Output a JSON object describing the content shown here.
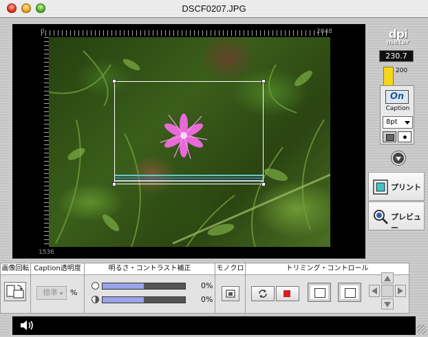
{
  "window": {
    "title": "DSCF0207.JPG"
  },
  "viewer": {
    "ruler_x_start": "0",
    "ruler_x_end": "2048",
    "ruler_y_end": "1536"
  },
  "dpi_meter": {
    "logo_top": "dpi",
    "logo_bottom": "meter",
    "value": "230.7",
    "max_label": "200"
  },
  "caption_panel": {
    "on_label": "On",
    "label": "Caption",
    "font_size": "8pt"
  },
  "side_buttons": {
    "print_label": "プリント",
    "preview_label": "プレビュー"
  },
  "controls": {
    "headers": {
      "rotate": "画像回転",
      "caption_opacity": "Caption透明度",
      "brightness_contrast": "明るさ・コントラスト補正",
      "mono": "モノクロ",
      "trimming": "トリミング・コントロール"
    },
    "opacity_select": "標準",
    "opacity_unit": "%",
    "brightness_value": "0%",
    "contrast_value": "0%",
    "brightness_level": 0.5,
    "contrast_level": 0.5
  },
  "colors": {
    "accent_yellow": "#f7d51d",
    "slider_fill": "#9aa3e8",
    "stop_red": "#d81e1e"
  }
}
